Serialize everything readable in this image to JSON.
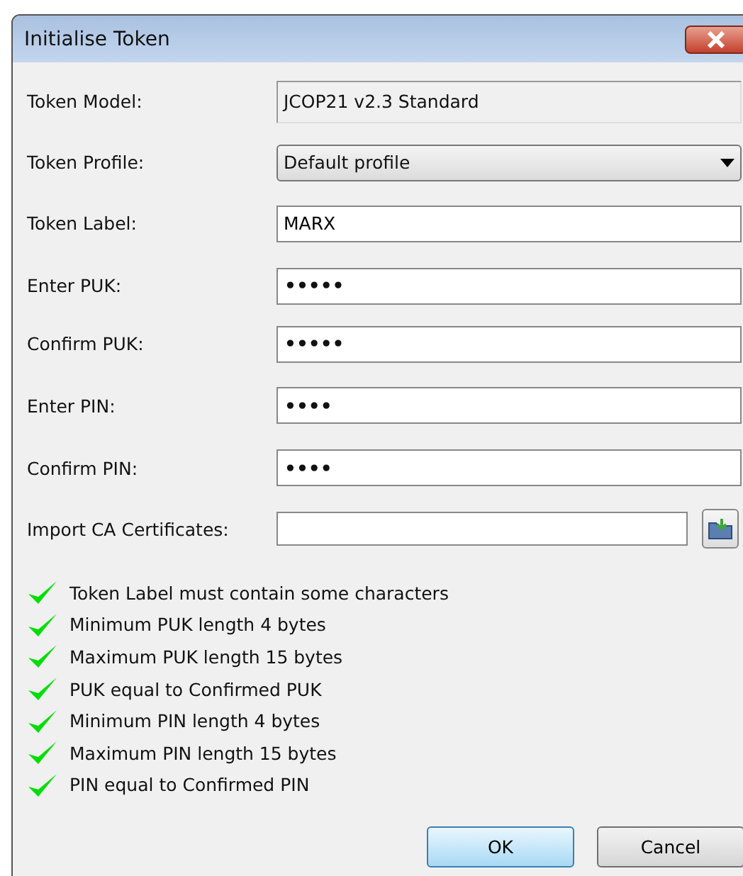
{
  "window": {
    "title": "Initialise Token"
  },
  "fields": [
    {
      "label": "Token Model:",
      "kind": "readonly",
      "value": "JCOP21 v2.3 Standard"
    },
    {
      "label": "Token Profile:",
      "kind": "dropdown",
      "value": "Default profile"
    },
    {
      "label": "Token Label:",
      "kind": "text",
      "value": "MARX"
    },
    {
      "label": "Enter PUK:",
      "kind": "password",
      "value": "•••••"
    },
    {
      "label": "Confirm PUK:",
      "kind": "password",
      "value": "•••••"
    },
    {
      "label": "Enter PIN:",
      "kind": "password",
      "value": "••••"
    },
    {
      "label": "Confirm PIN:",
      "kind": "password",
      "value": "••••"
    },
    {
      "label": "Import CA Certificates:",
      "kind": "file"
    }
  ],
  "checks": [
    {
      "text": "Token Label must contain some characters",
      "ok": true
    },
    {
      "text": "Minimum PUK length 4 bytes",
      "ok": true
    },
    {
      "text": "Maximum PUK length 15 bytes",
      "ok": true
    },
    {
      "text": "PUK equal to Confirmed PUK",
      "ok": true
    },
    {
      "text": "Minimum PIN length 4 bytes",
      "ok": true
    },
    {
      "text": "Maximum PIN length 15 bytes",
      "ok": true
    },
    {
      "text": "PIN equal to Confirmed PIN",
      "ok": true
    }
  ],
  "buttons": [
    {
      "label": "OK",
      "hovered": true
    },
    {
      "label": "Cancel",
      "hovered": false
    }
  ]
}
